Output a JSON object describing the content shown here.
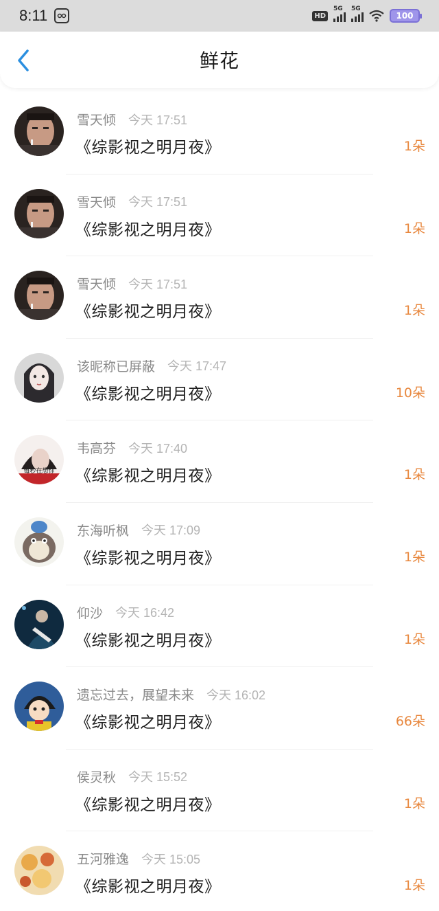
{
  "status_bar": {
    "time": "8:11",
    "hd_label": "HD",
    "sim1_label": "5G",
    "sim2_label": "5G",
    "battery": "100"
  },
  "nav": {
    "title": "鲜花"
  },
  "colors": {
    "count_accent": "#e8883f",
    "back_arrow": "#2b8fe0"
  },
  "items": [
    {
      "name": "雪天倾",
      "time": "今天 17:51",
      "book": "《综影视之明月夜》",
      "count": "1朵",
      "avatar": "man-portrait"
    },
    {
      "name": "雪天倾",
      "time": "今天 17:51",
      "book": "《综影视之明月夜》",
      "count": "1朵",
      "avatar": "man-portrait"
    },
    {
      "name": "雪天倾",
      "time": "今天 17:51",
      "book": "《综影视之明月夜》",
      "count": "1朵",
      "avatar": "man-portrait"
    },
    {
      "name": "该昵称已屏蔽",
      "time": "今天 17:47",
      "book": "《综影视之明月夜》",
      "count": "10朵",
      "avatar": "doll-girl"
    },
    {
      "name": "韦高芬",
      "time": "今天 17:40",
      "book": "《综影视之明月夜》",
      "count": "1朵",
      "avatar": "woman-red"
    },
    {
      "name": "东海听枫",
      "time": "今天 17:09",
      "book": "《综影视之明月夜》",
      "count": "1朵",
      "avatar": "totoro"
    },
    {
      "name": "仰沙",
      "time": "今天 16:42",
      "book": "《综影视之明月夜》",
      "count": "1朵",
      "avatar": "dark-blue-photo"
    },
    {
      "name": "遗忘过去，展望未来",
      "time": "今天 16:02",
      "book": "《综影视之明月夜》",
      "count": "66朵",
      "avatar": "anime-boy"
    },
    {
      "name": "侯灵秋",
      "time": "今天 15:52",
      "book": "《综影视之明月夜》",
      "count": "1朵",
      "avatar": "blank"
    },
    {
      "name": "五河雅逸",
      "time": "今天 15:05",
      "book": "《综影视之明月夜》",
      "count": "1朵",
      "avatar": "autumn-leaves"
    }
  ]
}
